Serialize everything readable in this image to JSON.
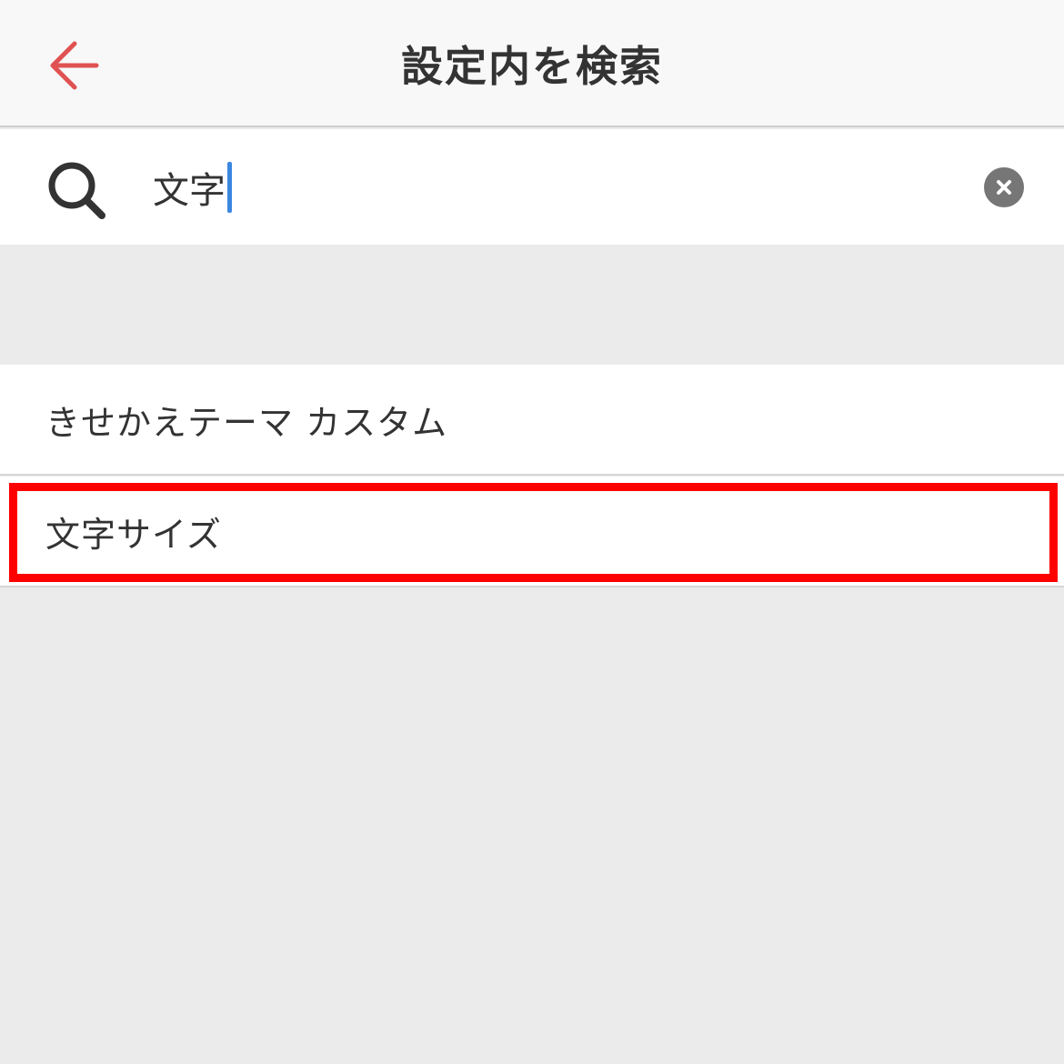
{
  "header": {
    "title": "設定内を検索",
    "back_icon": "arrow-left-icon",
    "accent_color": "#e05252"
  },
  "search": {
    "value": "文字",
    "search_icon": "search-icon",
    "clear_icon": "clear-circle-icon",
    "caret_color": "#3b87e0"
  },
  "results": [
    {
      "label": "きせかえテーマ カスタム"
    },
    {
      "label": "文字サイズ",
      "highlighted": true
    }
  ],
  "highlight_color": "#ff0000"
}
